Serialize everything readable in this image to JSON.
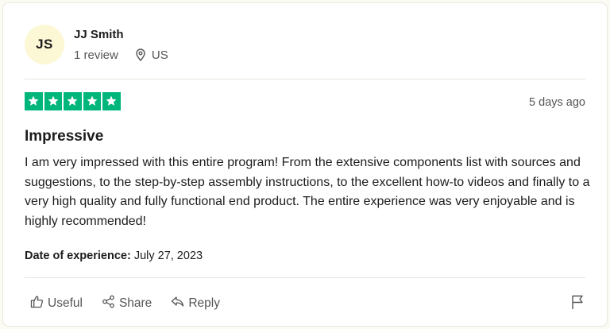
{
  "reviewer": {
    "initials": "JS",
    "name": "JJ Smith",
    "review_count": "1 review",
    "country": "US"
  },
  "review": {
    "rating": 5,
    "rating_max": 5,
    "date": "5 days ago",
    "title": "Impressive",
    "body": "I am very impressed with this entire program! From the extensive components list with sources and suggestions, to the step-by-step assembly instructions, to the excellent how-to videos and finally to a very high quality and fully functional end product. The entire experience was very enjoyable and is highly recommended!",
    "experience_label": "Date of experience:",
    "experience_date": "July 27, 2023"
  },
  "actions": {
    "useful": "Useful",
    "share": "Share",
    "reply": "Reply"
  },
  "icons": {
    "location": "location-pin-icon",
    "useful": "thumbs-up-icon",
    "share": "share-icon",
    "reply": "reply-icon",
    "flag": "flag-icon",
    "star": "star-icon"
  },
  "colors": {
    "star_bg": "#00b67a",
    "avatar_bg": "#fcf7d4"
  }
}
